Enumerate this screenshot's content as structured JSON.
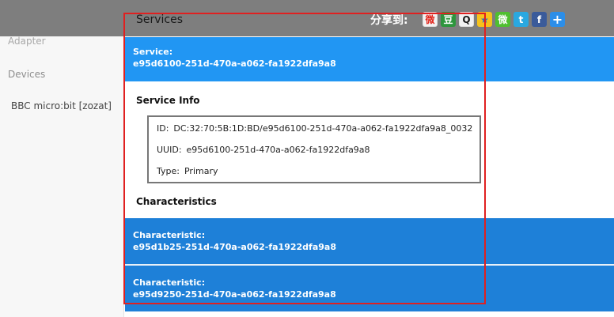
{
  "sidebar": {
    "adapter": "Adapter",
    "devices": "Devices",
    "device_name": "BBC micro:bit [zozat]"
  },
  "header": {
    "title": "Services",
    "share_label": "分享到:",
    "share_icons": [
      {
        "name": "weibo-icon",
        "glyph": "微"
      },
      {
        "name": "douban-icon",
        "glyph": "豆"
      },
      {
        "name": "qq-icon",
        "glyph": "Q"
      },
      {
        "name": "qzone-icon",
        "glyph": "★"
      },
      {
        "name": "wechat-icon",
        "glyph": "微"
      },
      {
        "name": "twitter-icon",
        "glyph": "t"
      },
      {
        "name": "facebook-icon",
        "glyph": "f"
      },
      {
        "name": "more-icon",
        "glyph": "+"
      }
    ]
  },
  "service": {
    "label": "Service:",
    "uuid": "e95d6100-251d-470a-a062-fa1922dfa9a8"
  },
  "service_info": {
    "title": "Service Info",
    "id_key": "ID:",
    "id_value": "DC:32:70:5B:1D:BD/e95d6100-251d-470a-a062-fa1922dfa9a8_0032",
    "uuid_key": "UUID:",
    "uuid_value": "e95d6100-251d-470a-a062-fa1922dfa9a8",
    "type_key": "Type:",
    "type_value": "Primary"
  },
  "characteristics": {
    "title": "Characteristics",
    "items": [
      {
        "label": "Characteristic:",
        "uuid": "e95d1b25-251d-470a-a062-fa1922dfa9a8"
      },
      {
        "label": "Characteristic:",
        "uuid": "e95d9250-251d-470a-a062-fa1922dfa9a8"
      }
    ]
  },
  "colors": {
    "service_bar": "#2196f3",
    "characteristic_bar": "#1e80d8",
    "header_bg": "#7e7e7e",
    "highlight_frame": "#e02020"
  }
}
